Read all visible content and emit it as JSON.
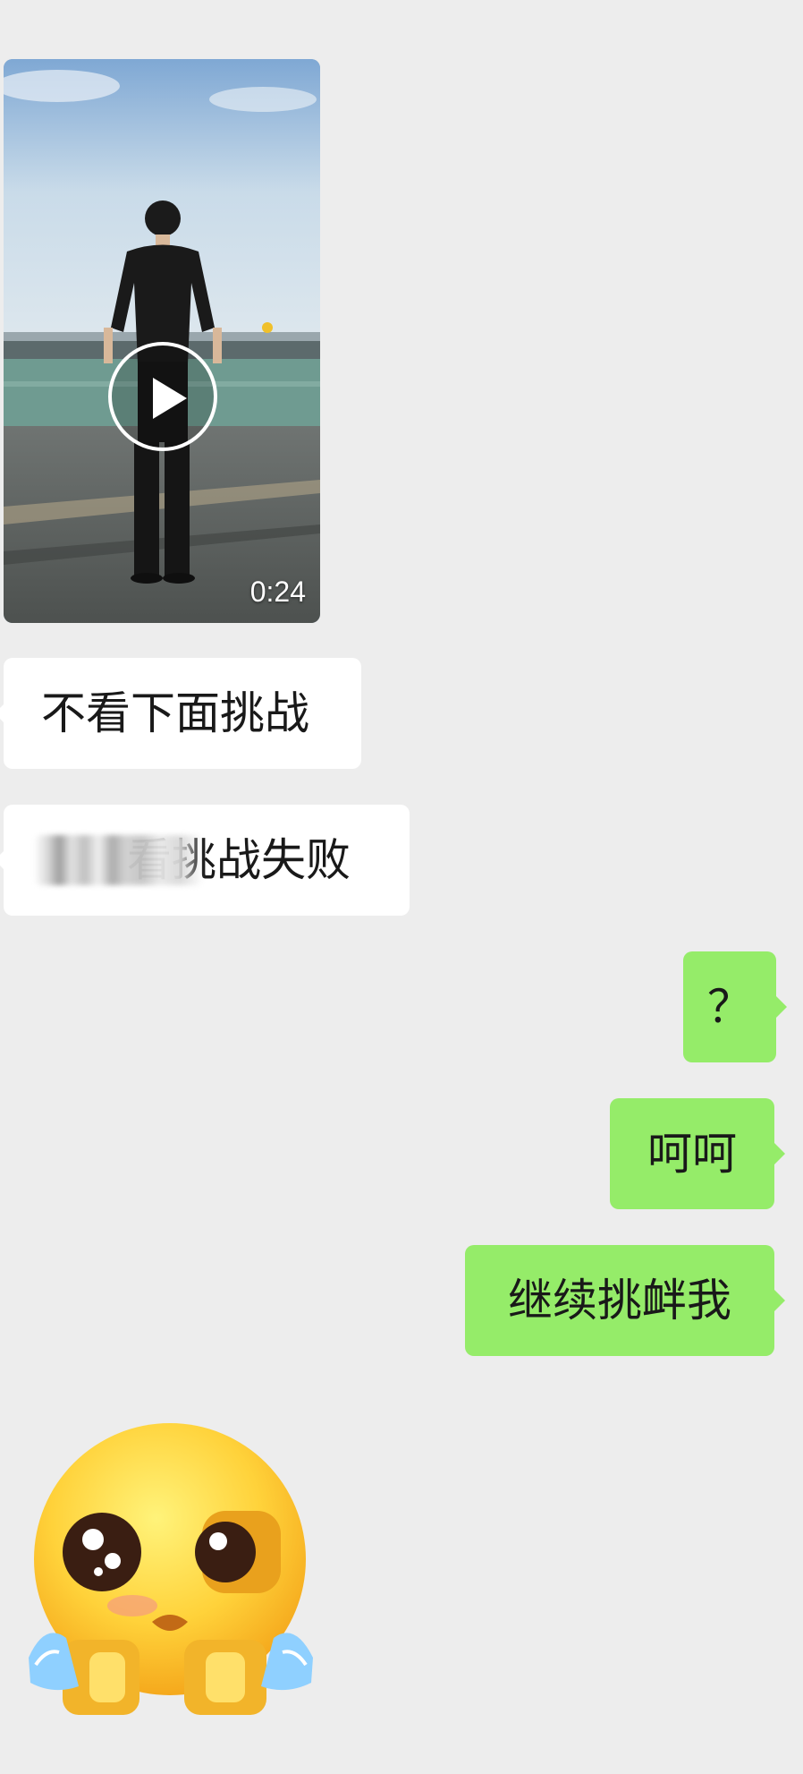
{
  "messages": [
    {
      "type": "video",
      "direction": "incoming",
      "duration": "0:24",
      "icon": "play-icon"
    },
    {
      "type": "text",
      "direction": "incoming",
      "text": "不看下面挑战"
    },
    {
      "type": "text",
      "direction": "incoming",
      "text": "看挑战失败",
      "note_visible": "first characters are pixelated/blurred"
    },
    {
      "type": "text",
      "direction": "outgoing",
      "text": "？"
    },
    {
      "type": "text",
      "direction": "outgoing",
      "text": "呵呵"
    },
    {
      "type": "text",
      "direction": "outgoing",
      "text": "继续挑衅我"
    },
    {
      "type": "sticker",
      "direction": "incoming",
      "icon": "crying-emoji-sticker"
    }
  ],
  "colors": {
    "background": "#ededed",
    "incoming_bubble": "#ffffff",
    "outgoing_bubble": "#95ec69",
    "text": "#191919"
  }
}
